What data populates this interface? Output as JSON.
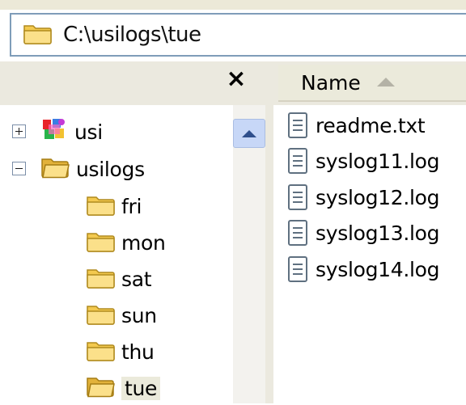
{
  "address": {
    "path": "C:\\usilogs\\tue",
    "icon": "folder-icon"
  },
  "tree_pane": {
    "close_label": "×"
  },
  "file_pane": {
    "column_header": "Name",
    "sort": "ascending"
  },
  "tree": {
    "items": [
      {
        "label": "usi",
        "icon": "app-icon",
        "expander": "+"
      },
      {
        "label": "usilogs",
        "icon": "folder-open-icon",
        "expander": "-"
      },
      {
        "label": "fri",
        "icon": "folder-icon"
      },
      {
        "label": "mon",
        "icon": "folder-icon"
      },
      {
        "label": "sat",
        "icon": "folder-icon"
      },
      {
        "label": "sun",
        "icon": "folder-icon"
      },
      {
        "label": "thu",
        "icon": "folder-icon"
      },
      {
        "label": "tue",
        "icon": "folder-open-icon",
        "selected": true
      }
    ]
  },
  "files": [
    {
      "name": "readme.txt",
      "icon": "text-file-icon"
    },
    {
      "name": "syslog11.log",
      "icon": "text-file-icon"
    },
    {
      "name": "syslog12.log",
      "icon": "text-file-icon"
    },
    {
      "name": "syslog13.log",
      "icon": "text-file-icon"
    },
    {
      "name": "syslog14.log",
      "icon": "text-file-icon"
    }
  ],
  "colors": {
    "chrome": "#ebe9df",
    "address_border": "#7f9db9",
    "folder": "#f3c94f",
    "selection": "#ebeadb"
  }
}
